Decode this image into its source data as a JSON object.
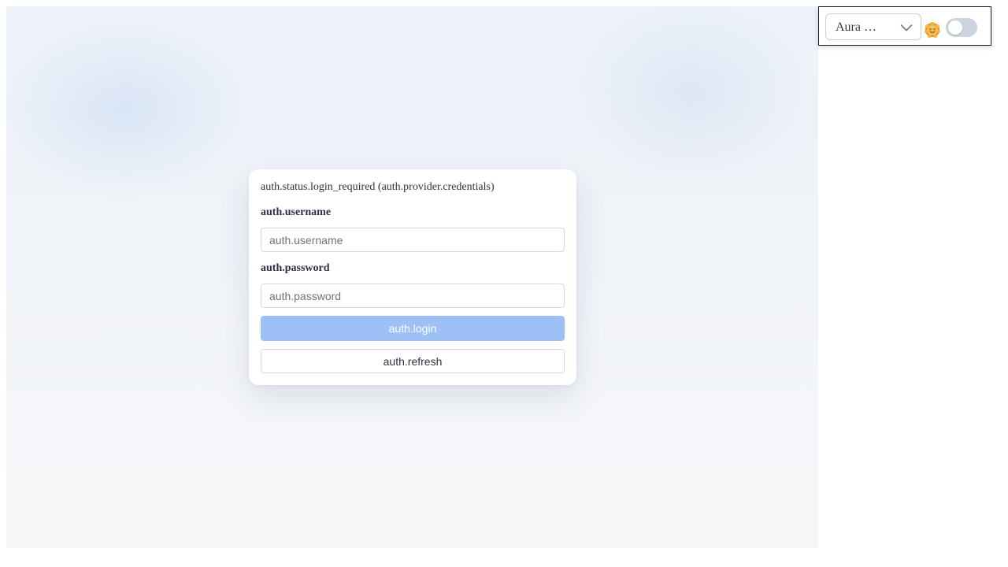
{
  "auth": {
    "status_text": "auth.status.login_required (auth.provider.credentials)",
    "username_label": "auth.username",
    "username_placeholder": "auth.username",
    "password_label": "auth.password",
    "password_placeholder": "auth.password",
    "login_label": "auth.login",
    "refresh_label": "auth.refresh"
  },
  "theme_panel": {
    "theme_select_value": "Aura …",
    "mode_icon": "sun-face-icon",
    "dark_mode_enabled": false
  },
  "colors": {
    "login_button": "#9dc1f7",
    "toggle_track": "#cbd4e0",
    "text": "#2b3240"
  }
}
